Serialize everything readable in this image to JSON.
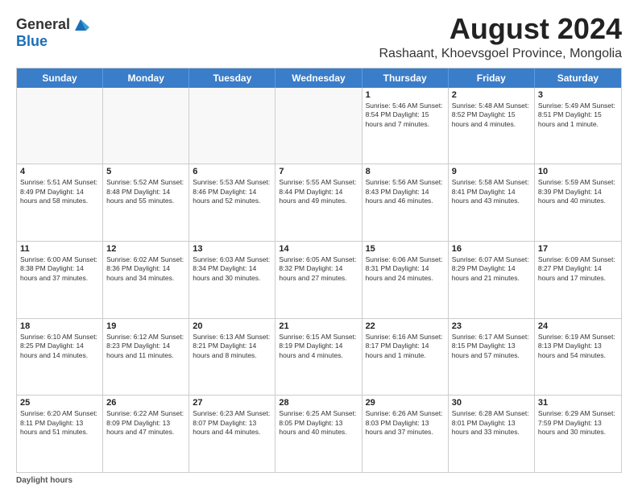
{
  "logo": {
    "line1": "General",
    "line2": "Blue"
  },
  "title": "August 2024",
  "subtitle": "Rashaant, Khoevsgoel Province, Mongolia",
  "header_days": [
    "Sunday",
    "Monday",
    "Tuesday",
    "Wednesday",
    "Thursday",
    "Friday",
    "Saturday"
  ],
  "footer": {
    "label": "Daylight hours"
  },
  "rows": [
    [
      {
        "day": "",
        "info": "",
        "empty": true
      },
      {
        "day": "",
        "info": "",
        "empty": true
      },
      {
        "day": "",
        "info": "",
        "empty": true
      },
      {
        "day": "",
        "info": "",
        "empty": true
      },
      {
        "day": "1",
        "info": "Sunrise: 5:46 AM\nSunset: 8:54 PM\nDaylight: 15 hours\nand 7 minutes.",
        "empty": false
      },
      {
        "day": "2",
        "info": "Sunrise: 5:48 AM\nSunset: 8:52 PM\nDaylight: 15 hours\nand 4 minutes.",
        "empty": false
      },
      {
        "day": "3",
        "info": "Sunrise: 5:49 AM\nSunset: 8:51 PM\nDaylight: 15 hours\nand 1 minute.",
        "empty": false
      }
    ],
    [
      {
        "day": "4",
        "info": "Sunrise: 5:51 AM\nSunset: 8:49 PM\nDaylight: 14 hours\nand 58 minutes.",
        "empty": false
      },
      {
        "day": "5",
        "info": "Sunrise: 5:52 AM\nSunset: 8:48 PM\nDaylight: 14 hours\nand 55 minutes.",
        "empty": false
      },
      {
        "day": "6",
        "info": "Sunrise: 5:53 AM\nSunset: 8:46 PM\nDaylight: 14 hours\nand 52 minutes.",
        "empty": false
      },
      {
        "day": "7",
        "info": "Sunrise: 5:55 AM\nSunset: 8:44 PM\nDaylight: 14 hours\nand 49 minutes.",
        "empty": false
      },
      {
        "day": "8",
        "info": "Sunrise: 5:56 AM\nSunset: 8:43 PM\nDaylight: 14 hours\nand 46 minutes.",
        "empty": false
      },
      {
        "day": "9",
        "info": "Sunrise: 5:58 AM\nSunset: 8:41 PM\nDaylight: 14 hours\nand 43 minutes.",
        "empty": false
      },
      {
        "day": "10",
        "info": "Sunrise: 5:59 AM\nSunset: 8:39 PM\nDaylight: 14 hours\nand 40 minutes.",
        "empty": false
      }
    ],
    [
      {
        "day": "11",
        "info": "Sunrise: 6:00 AM\nSunset: 8:38 PM\nDaylight: 14 hours\nand 37 minutes.",
        "empty": false
      },
      {
        "day": "12",
        "info": "Sunrise: 6:02 AM\nSunset: 8:36 PM\nDaylight: 14 hours\nand 34 minutes.",
        "empty": false
      },
      {
        "day": "13",
        "info": "Sunrise: 6:03 AM\nSunset: 8:34 PM\nDaylight: 14 hours\nand 30 minutes.",
        "empty": false
      },
      {
        "day": "14",
        "info": "Sunrise: 6:05 AM\nSunset: 8:32 PM\nDaylight: 14 hours\nand 27 minutes.",
        "empty": false
      },
      {
        "day": "15",
        "info": "Sunrise: 6:06 AM\nSunset: 8:31 PM\nDaylight: 14 hours\nand 24 minutes.",
        "empty": false
      },
      {
        "day": "16",
        "info": "Sunrise: 6:07 AM\nSunset: 8:29 PM\nDaylight: 14 hours\nand 21 minutes.",
        "empty": false
      },
      {
        "day": "17",
        "info": "Sunrise: 6:09 AM\nSunset: 8:27 PM\nDaylight: 14 hours\nand 17 minutes.",
        "empty": false
      }
    ],
    [
      {
        "day": "18",
        "info": "Sunrise: 6:10 AM\nSunset: 8:25 PM\nDaylight: 14 hours\nand 14 minutes.",
        "empty": false
      },
      {
        "day": "19",
        "info": "Sunrise: 6:12 AM\nSunset: 8:23 PM\nDaylight: 14 hours\nand 11 minutes.",
        "empty": false
      },
      {
        "day": "20",
        "info": "Sunrise: 6:13 AM\nSunset: 8:21 PM\nDaylight: 14 hours\nand 8 minutes.",
        "empty": false
      },
      {
        "day": "21",
        "info": "Sunrise: 6:15 AM\nSunset: 8:19 PM\nDaylight: 14 hours\nand 4 minutes.",
        "empty": false
      },
      {
        "day": "22",
        "info": "Sunrise: 6:16 AM\nSunset: 8:17 PM\nDaylight: 14 hours\nand 1 minute.",
        "empty": false
      },
      {
        "day": "23",
        "info": "Sunrise: 6:17 AM\nSunset: 8:15 PM\nDaylight: 13 hours\nand 57 minutes.",
        "empty": false
      },
      {
        "day": "24",
        "info": "Sunrise: 6:19 AM\nSunset: 8:13 PM\nDaylight: 13 hours\nand 54 minutes.",
        "empty": false
      }
    ],
    [
      {
        "day": "25",
        "info": "Sunrise: 6:20 AM\nSunset: 8:11 PM\nDaylight: 13 hours\nand 51 minutes.",
        "empty": false
      },
      {
        "day": "26",
        "info": "Sunrise: 6:22 AM\nSunset: 8:09 PM\nDaylight: 13 hours\nand 47 minutes.",
        "empty": false
      },
      {
        "day": "27",
        "info": "Sunrise: 6:23 AM\nSunset: 8:07 PM\nDaylight: 13 hours\nand 44 minutes.",
        "empty": false
      },
      {
        "day": "28",
        "info": "Sunrise: 6:25 AM\nSunset: 8:05 PM\nDaylight: 13 hours\nand 40 minutes.",
        "empty": false
      },
      {
        "day": "29",
        "info": "Sunrise: 6:26 AM\nSunset: 8:03 PM\nDaylight: 13 hours\nand 37 minutes.",
        "empty": false
      },
      {
        "day": "30",
        "info": "Sunrise: 6:28 AM\nSunset: 8:01 PM\nDaylight: 13 hours\nand 33 minutes.",
        "empty": false
      },
      {
        "day": "31",
        "info": "Sunrise: 6:29 AM\nSunset: 7:59 PM\nDaylight: 13 hours\nand 30 minutes.",
        "empty": false
      }
    ]
  ]
}
